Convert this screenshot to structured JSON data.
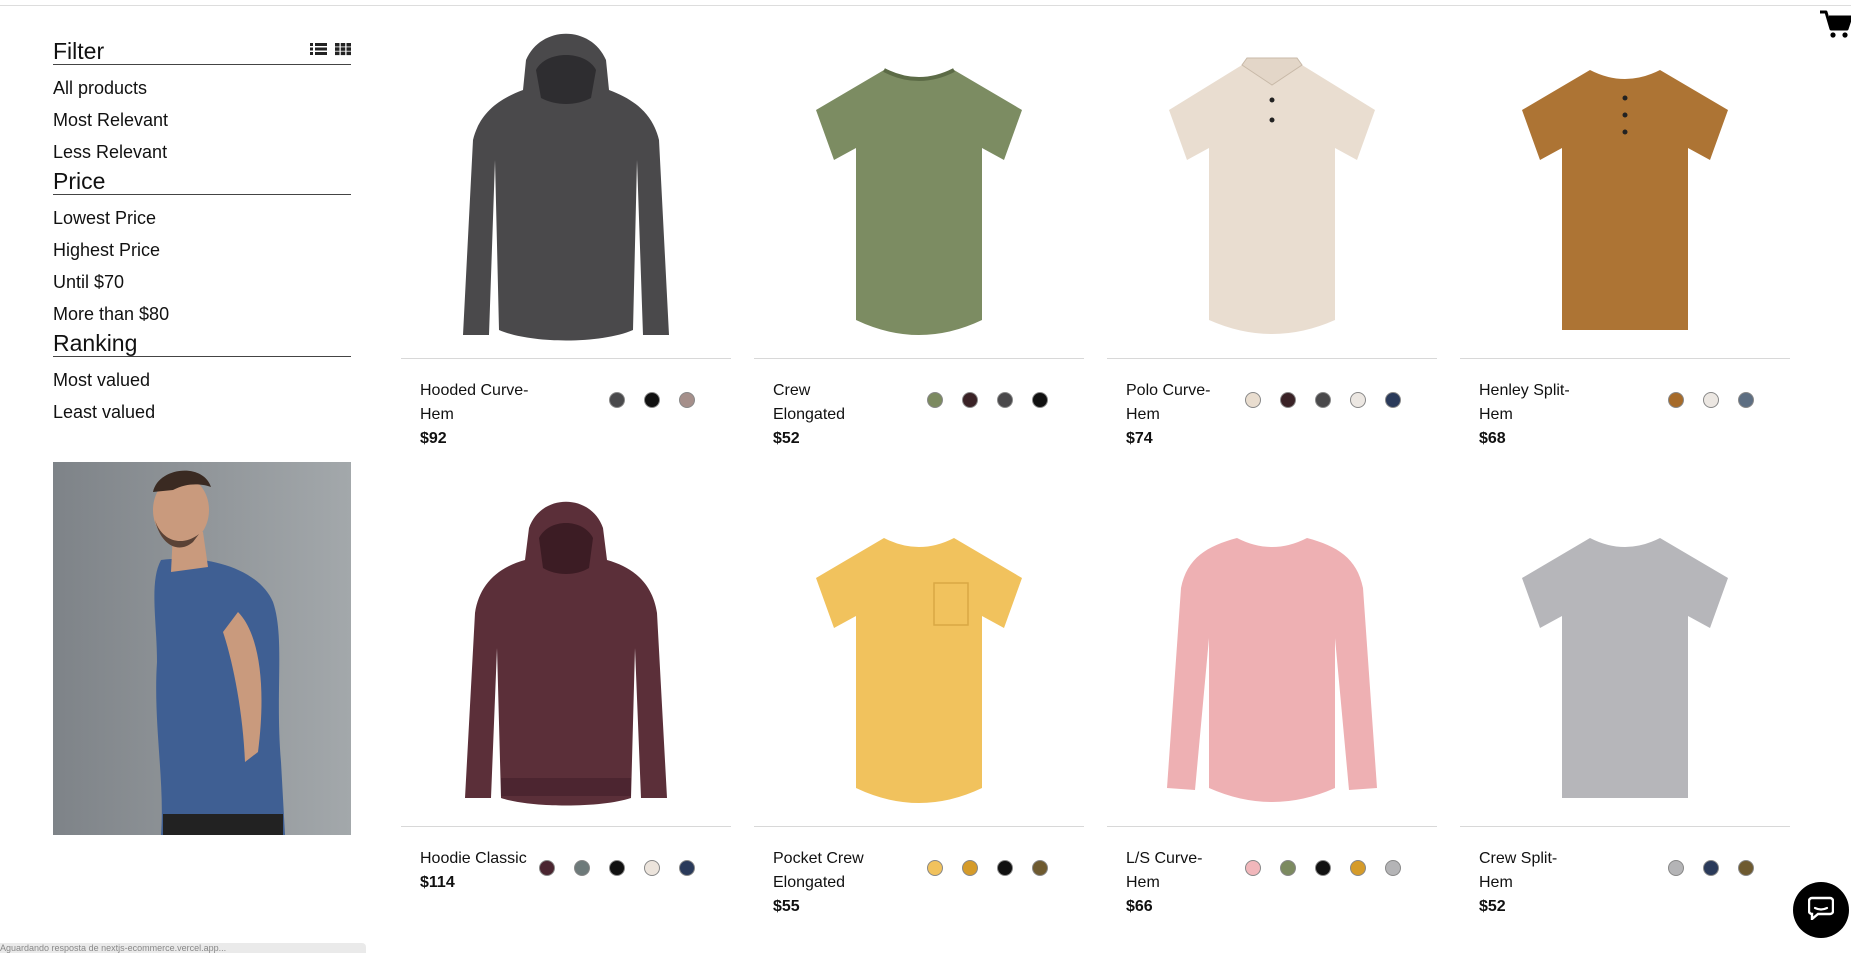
{
  "filter": {
    "title": "Filter",
    "items": [
      "All products",
      "Most Relevant",
      "Less Relevant"
    ]
  },
  "price": {
    "title": "Price",
    "items": [
      "Lowest Price",
      "Highest Price",
      "Until $70",
      "More than $80"
    ]
  },
  "ranking": {
    "title": "Ranking",
    "items": [
      "Most valued",
      "Least valued"
    ]
  },
  "icons": {
    "list_view": "list-view-icon",
    "grid_view": "grid-view-icon",
    "cart": "cart-icon",
    "chat": "chat-icon"
  },
  "products": [
    {
      "name": "Hooded Curve-Hem",
      "price": "$92",
      "kind": "hoodie-long",
      "color": "#4a494b",
      "swatches": [
        "#4a4a4c",
        "#111111",
        "#a58f8a"
      ]
    },
    {
      "name": "Crew Elongated",
      "price": "$52",
      "kind": "tee-curve",
      "color": "#7c8c62",
      "swatches": [
        "#7c8a60",
        "#3a2226",
        "#4a494b",
        "#111111"
      ]
    },
    {
      "name": "Polo Curve-Hem",
      "price": "$74",
      "kind": "polo",
      "color": "#e9ddd0",
      "swatches": [
        "#e9ddcf",
        "#3a2226",
        "#4a494b",
        "#ece7e2",
        "#2a3a5a"
      ]
    },
    {
      "name": "Henley Split-Hem",
      "price": "$68",
      "kind": "henley",
      "color": "#ad7434",
      "swatches": [
        "#a66b2a",
        "#ece7e2",
        "#5d6e82"
      ]
    },
    {
      "name": "Hoodie Classic",
      "price": "$114",
      "kind": "hoodie",
      "color": "#5b2f39",
      "swatches": [
        "#4a2530",
        "#6e7a7a",
        "#111111",
        "#ece4dc",
        "#2a3a5a"
      ]
    },
    {
      "name": "Pocket Crew Elongated",
      "price": "$55",
      "kind": "tee-pocket",
      "color": "#f1c25d",
      "swatches": [
        "#f1c25d",
        "#d59b2a",
        "#111111",
        "#6e5a30"
      ]
    },
    {
      "name": "L/S Curve-Hem",
      "price": "$66",
      "kind": "longsleeve",
      "color": "#eeb0b3",
      "swatches": [
        "#f1b7bb",
        "#7c8a60",
        "#111111",
        "#d59b2a",
        "#b4b4b6"
      ]
    },
    {
      "name": "Crew Split-Hem",
      "price": "$52",
      "kind": "tee-flat",
      "color": "#b6b6ba",
      "swatches": [
        "#b4b4b6",
        "#2a3a5a",
        "#6e5a30"
      ]
    }
  ],
  "status_text": "Aguardando resposta de nextjs-ecommerce.vercel.app..."
}
